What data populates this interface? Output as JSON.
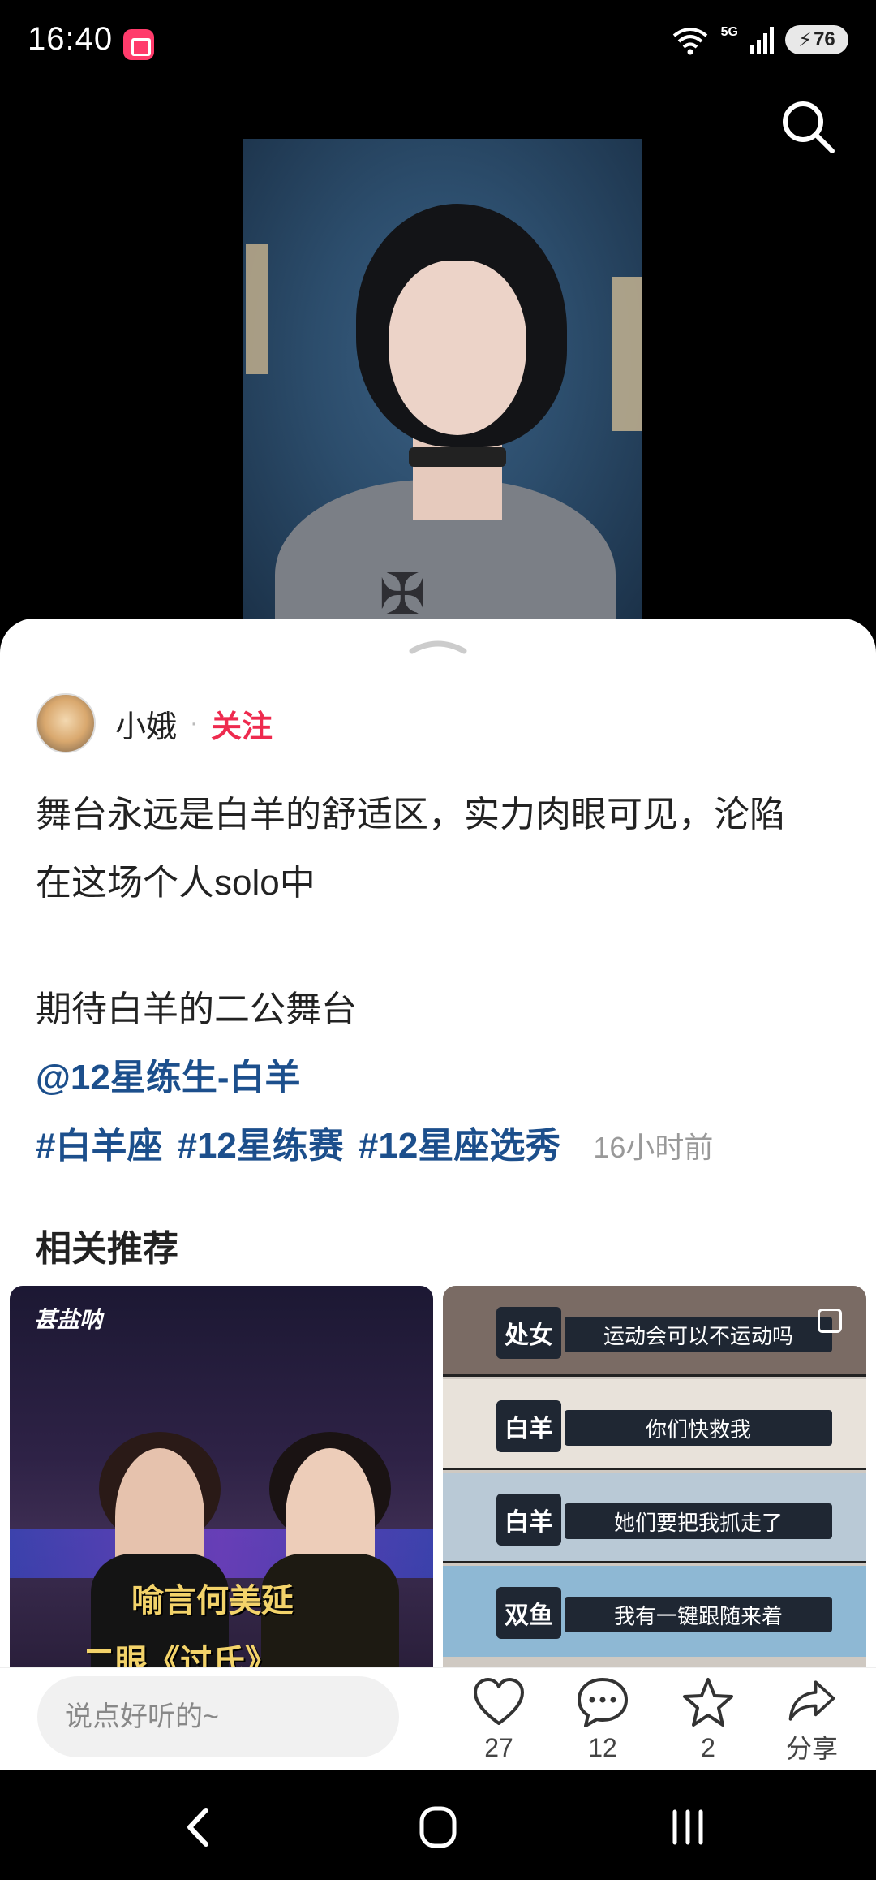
{
  "status_bar": {
    "time": "16:40",
    "network": "5G",
    "battery": "76"
  },
  "post": {
    "author": "小娥",
    "follow_label": "关注",
    "body_lines": [
      "舞台永远是白羊的舒适区，实力肉眼可见，沦陷",
      "在这场个人solo中"
    ],
    "body_line3": "期待白羊的二公舞台",
    "mention": "@12星练生-白羊",
    "tags": [
      "#白羊座",
      "#12星练赛",
      "#12星座选秀"
    ],
    "time": "16小时前"
  },
  "related": {
    "title": "相关推荐",
    "left_card": {
      "logo_text": "甚盐呐",
      "caption_line1": "喻言何美延",
      "caption_line2": "二眼《过氏》"
    },
    "right_card": {
      "panels": [
        {
          "speaker": "处女",
          "line": "运动会可以不运动吗"
        },
        {
          "speaker": "白羊",
          "line": "你们快救我"
        },
        {
          "speaker": "白羊",
          "line": "她们要把我抓走了"
        },
        {
          "speaker": "双鱼",
          "line": "我有一键跟随来着"
        }
      ]
    }
  },
  "bottom_bar": {
    "comment_placeholder": "说点好听的~",
    "like_count": "27",
    "comment_count": "12",
    "favorite_count": "2",
    "share_label": "分享"
  },
  "icons": {
    "search": "search-icon",
    "like": "heart-icon",
    "comment": "comment-icon",
    "favorite": "star-icon",
    "share": "share-icon",
    "nav_back": "back-icon",
    "nav_home": "home-icon",
    "nav_recents": "recents-icon"
  },
  "colors": {
    "follow": "#ee2a4e",
    "link": "#1c4f8c"
  }
}
